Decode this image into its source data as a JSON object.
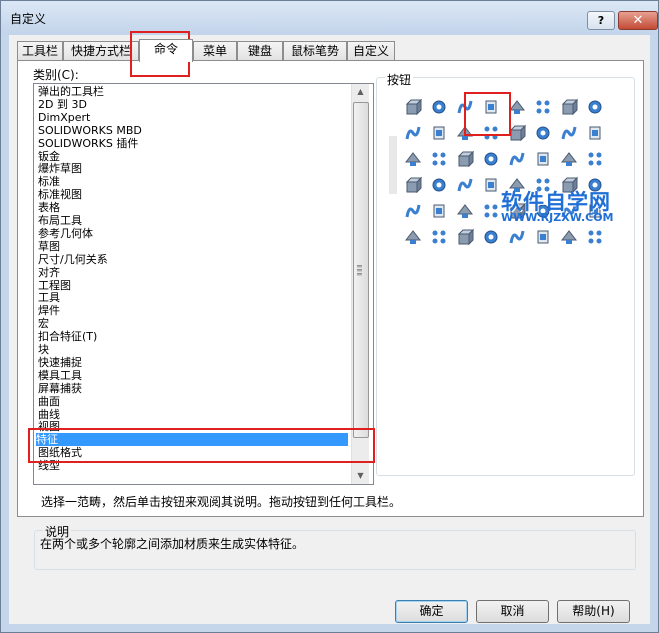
{
  "window": {
    "title": "自定义",
    "help_label": "?",
    "close_label": "✕"
  },
  "tabs": [
    {
      "label": "工具栏"
    },
    {
      "label": "快捷方式栏"
    },
    {
      "label": "命令"
    },
    {
      "label": "菜单"
    },
    {
      "label": "键盘"
    },
    {
      "label": "鼠标笔势"
    },
    {
      "label": "自定义"
    }
  ],
  "category": {
    "label": "类别(C):",
    "items": [
      "弹出的工具栏",
      "2D 到 3D",
      "DimXpert",
      "SOLIDWORKS MBD",
      "SOLIDWORKS 插件",
      "钣金",
      "爆炸草图",
      "标准",
      "标准视图",
      "表格",
      "布局工具",
      "参考几何体",
      "草图",
      "尺寸/几何关系",
      "对齐",
      "工程图",
      "工具",
      "焊件",
      "宏",
      "扣合特征(T)",
      "块",
      "快速捕捉",
      "模具工具",
      "屏幕捕获",
      "曲面",
      "曲线",
      "视图",
      "特征",
      "图纸格式",
      "线型"
    ],
    "selected": "特征"
  },
  "buttons": {
    "label": "按钮",
    "icons": [
      "extruded-boss-icon",
      "revolved-boss-icon",
      "swept-boss-icon",
      "lofted-boss-icon",
      "boundary-boss-icon",
      "extruded-cut-icon",
      "hole-wizard-icon",
      "revolved-cut-icon",
      "swept-cut-icon",
      "lofted-cut-icon",
      "boundary-cut-icon",
      "fillet-icon",
      "chamfer-icon",
      "rib-icon",
      "shell-icon",
      "draft-icon",
      "dome-icon",
      "wrap-icon",
      "intersect-icon",
      "linear-pattern-icon",
      "circular-pattern-icon",
      "mirror-icon",
      "curve-pattern-icon",
      "sketch-pattern-icon",
      "freeform-icon",
      "split-line-icon",
      "move-face-icon",
      "delete-face-icon",
      "replace-face-icon",
      "combine-icon",
      "split-icon",
      "indent-icon",
      "flex-icon",
      "deform-icon",
      "scale-icon",
      "table-pattern-icon",
      "fill-pattern-icon",
      "variable-pattern-icon",
      "thicken-icon",
      "cosmetic-thread-icon",
      "delete-body-icon",
      "hole-series-icon",
      "simple-hole-icon",
      "advanced-hole-icon",
      "library-feature-icon",
      "instant3d-icon",
      "feature-check-icon",
      "3d-texture-icon"
    ]
  },
  "hint": "选择一范畴，然后单击按钮来观阅其说明。拖动按钮到任何工具栏。",
  "description": {
    "label": "说明",
    "text": "在两个或多个轮廓之间添加材质来生成实体特征。"
  },
  "actions": {
    "ok": "确定",
    "cancel": "取消",
    "help": "帮助(H)"
  },
  "watermark": {
    "title": "软件自学网",
    "url": "WWW.RJZXW.COM"
  },
  "colors": {
    "selection": "#3399ff",
    "highlight_box": "#e0201e",
    "icon_blue": "#3a7fd0",
    "icon_gray": "#8b9bb0"
  }
}
